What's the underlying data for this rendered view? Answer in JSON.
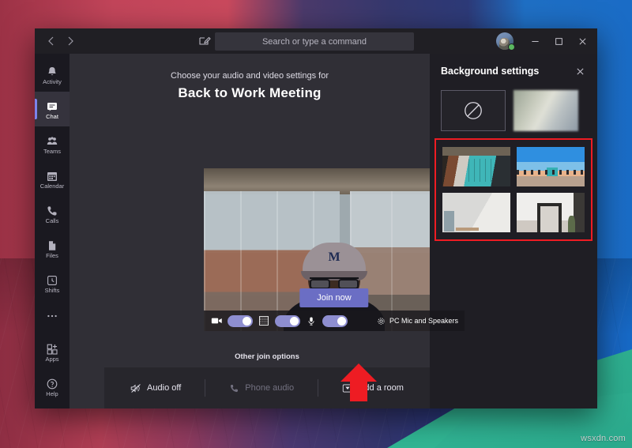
{
  "desktop": {
    "watermark": "wsxdn.com"
  },
  "titlebar": {
    "back_icon": "chevron-left-icon",
    "forward_icon": "chevron-right-icon",
    "compose_icon": "compose-new-chat-icon",
    "search_placeholder": "Search or type a command",
    "avatar_icon": "user-avatar",
    "presence": "available",
    "minimize_label": "–",
    "maximize_label": "☐",
    "close_label": "✕"
  },
  "rail": {
    "items": [
      {
        "label": "Activity",
        "icon": "bell-icon",
        "active": false
      },
      {
        "label": "Chat",
        "icon": "chat-bubble-icon",
        "active": true
      },
      {
        "label": "Teams",
        "icon": "people-icon",
        "active": false
      },
      {
        "label": "Calendar",
        "icon": "calendar-icon",
        "active": false
      },
      {
        "label": "Calls",
        "icon": "phone-icon",
        "active": false
      },
      {
        "label": "Files",
        "icon": "file-icon",
        "active": false
      },
      {
        "label": "Shifts",
        "icon": "clock-icon",
        "active": false
      }
    ],
    "more_icon": "ellipsis-icon",
    "bottom": [
      {
        "label": "Apps",
        "icon": "apps-grid-icon"
      },
      {
        "label": "Help",
        "icon": "question-circle-icon"
      }
    ]
  },
  "meeting": {
    "subtitle": "Choose your audio and video settings for",
    "title": "Back to Work Meeting",
    "join_now_label": "Join now",
    "other_join_label": "Other join options",
    "controls": {
      "camera_icon": "video-camera-icon",
      "camera_toggle": "on",
      "background_icon": "background-effects-icon",
      "background_toggle": "on",
      "mic_icon": "microphone-icon",
      "mic_toggle": "on",
      "device_icon": "gear-icon",
      "device_label": "PC Mic and Speakers"
    },
    "join_options": [
      {
        "label": "Audio off",
        "icon": "speaker-muted-icon",
        "disabled": false
      },
      {
        "label": "Phone audio",
        "icon": "phone-icon",
        "disabled": true
      },
      {
        "label": "Add a room",
        "icon": "room-device-icon",
        "disabled": false
      }
    ]
  },
  "background_settings": {
    "title": "Background settings",
    "close_icon": "close-icon",
    "top_options": [
      {
        "name": "none",
        "label": "None",
        "icon": "no-background-icon"
      },
      {
        "name": "blur",
        "label": "Blur",
        "icon": "blur-thumbnail"
      }
    ],
    "images": [
      {
        "name": "office-interior-teal"
      },
      {
        "name": "beach-lifeguard-tower"
      },
      {
        "name": "white-room-window"
      },
      {
        "name": "doorway-hallway"
      }
    ],
    "highlight_color": "#ee1c23"
  },
  "annotation": {
    "arrow": "red-up-arrow",
    "color": "#ee1c23"
  }
}
